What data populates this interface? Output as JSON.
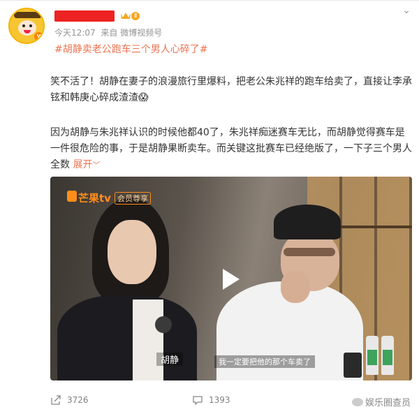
{
  "post": {
    "author": {
      "level_badge": "Ⅱ"
    },
    "meta": {
      "time": "今天12:07",
      "source": "来自 微博视频号"
    },
    "hashtag": "#胡静卖老公跑车三个男人心碎了#",
    "paragraphs": [
      "笑不活了！胡静在妻子的浪漫旅行里爆料，把老公朱兆祥的跑车给卖了，直接让李承铉和韩庚心碎成渣渣😱",
      "因为胡静与朱兆祥认识的时候他都40了，朱兆祥痴迷赛车无比，而胡静觉得赛车是一件很危险的事，于是胡静果断卖车。而关键这批赛车已经绝版了，一下子三个男人全数"
    ],
    "expand_label": "展开",
    "video": {
      "channel_logo": "芒果tv",
      "channel_tag": "会员尊享",
      "name_caption": "胡静",
      "subtitle": "我一定要把他的那个车卖了"
    },
    "actions": {
      "share_count": "3726",
      "comment_count": "1393"
    },
    "watermark": "娱乐圈查员"
  },
  "colors": {
    "accent_link": "#eb7350",
    "redaction": "#ee2222",
    "meta_gray": "#939393"
  }
}
